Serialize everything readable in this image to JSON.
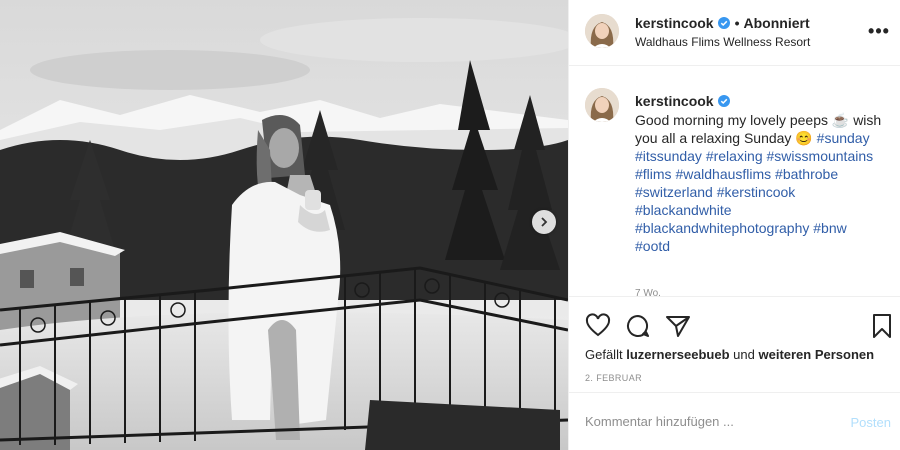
{
  "post": {
    "username": "kerstincook",
    "separator": "•",
    "follow_status": "Abonniert",
    "location": "Waldhaus Flims Wellness Resort",
    "more_label": "•••",
    "caption_text": "Good morning my lovely peeps ☕️ wish you all a relaxing Sunday 😊",
    "hashtags": "#sunday #itssunday #relaxing #swissmountains #flims #waldhausflims #bathrobe #switzerland #kerstincook #blackandwhite #blackandwhitephotography #bnw #ootd",
    "time_ago": "7 Wo.",
    "likes_prefix": "Gefällt",
    "likes_user": "luzernerseebueb",
    "likes_and": "und",
    "likes_others": "weiteren Personen",
    "date": "2. FEBRUAR",
    "comment_placeholder": "Kommentar hinzufügen ...",
    "post_button": "Posten"
  },
  "icons": {
    "verified": "verified-badge-icon",
    "like": "heart-icon",
    "comment": "comment-bubble-icon",
    "share": "paper-plane-icon",
    "save": "bookmark-icon",
    "next": "chevron-right-icon"
  },
  "colors": {
    "verified_blue": "#3897f0",
    "hashtag_blue": "#315ea8",
    "post_button_disabled": "#b2dffc",
    "muted_text": "#8e8e8e",
    "border": "#efefef"
  }
}
